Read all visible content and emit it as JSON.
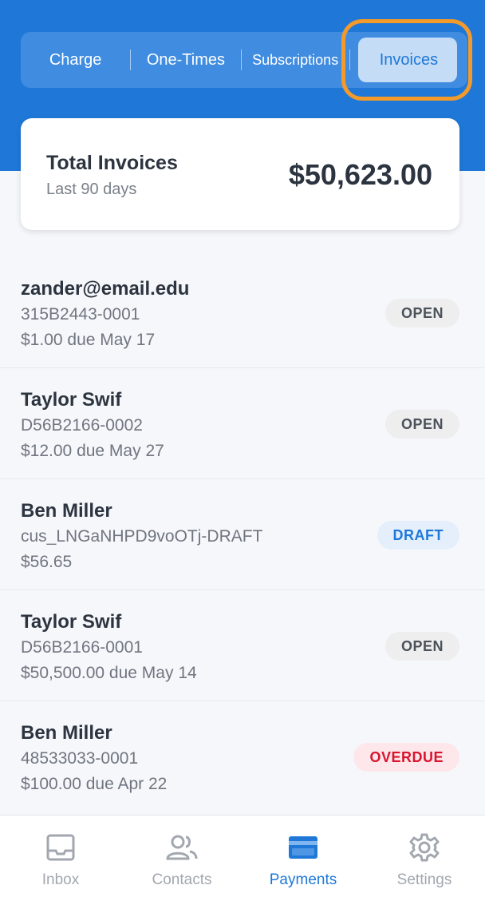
{
  "colors": {
    "brand": "#1f78d8",
    "highlight": "#f39a2b",
    "status_open_bg": "#eeeeef",
    "status_open_text": "#4c525a",
    "status_draft_bg": "#e4effb",
    "status_draft_text": "#1f78d8",
    "status_overdue_bg": "#fde7ea",
    "status_overdue_text": "#d9142e"
  },
  "tabs": [
    {
      "label": "Charge",
      "active": false
    },
    {
      "label": "One-Times",
      "active": false
    },
    {
      "label": "Subscriptions",
      "active": false
    },
    {
      "label": "Invoices",
      "active": true
    }
  ],
  "summary": {
    "title": "Total Invoices",
    "subtitle": "Last 90 days",
    "amount": "$50,623.00"
  },
  "invoices": [
    {
      "name": "zander@email.edu",
      "id": "315B2443-0001",
      "amount": "$1.00 due May 17",
      "status": "OPEN",
      "status_type": "open"
    },
    {
      "name": "Taylor Swif",
      "id": "D56B2166-0002",
      "amount": "$12.00 due May 27",
      "status": "OPEN",
      "status_type": "open"
    },
    {
      "name": "Ben Miller",
      "id": "cus_LNGaNHPD9voOTj-DRAFT",
      "amount": "$56.65",
      "status": "DRAFT",
      "status_type": "draft"
    },
    {
      "name": "Taylor Swif",
      "id": "D56B2166-0001",
      "amount": "$50,500.00 due May 14",
      "status": "OPEN",
      "status_type": "open"
    },
    {
      "name": "Ben Miller",
      "id": "48533033-0001",
      "amount": "$100.00 due Apr 22",
      "status": "OVERDUE",
      "status_type": "overdue"
    }
  ],
  "nav": [
    {
      "label": "Inbox",
      "icon": "inbox-icon",
      "active": false
    },
    {
      "label": "Contacts",
      "icon": "contacts-icon",
      "active": false
    },
    {
      "label": "Payments",
      "icon": "payments-card-icon",
      "active": true
    },
    {
      "label": "Settings",
      "icon": "gear-icon",
      "active": false
    }
  ]
}
